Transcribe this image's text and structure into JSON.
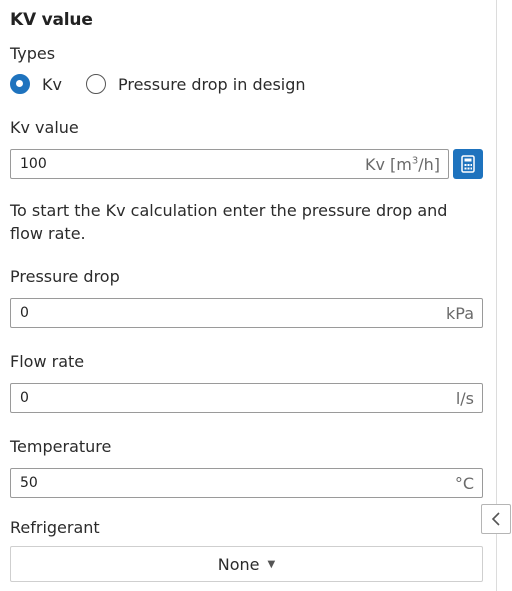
{
  "panel": {
    "title": "KV value",
    "types_label": "Types",
    "types": [
      {
        "label": "Kv",
        "selected": true
      },
      {
        "label": "Pressure drop in design",
        "selected": false
      }
    ],
    "kv_label": "Kv value",
    "kv_value": "100",
    "kv_unit_prefix": "Kv [m",
    "kv_unit_sup": "3",
    "kv_unit_suffix": "/h]",
    "info_text": "To start the Kv calculation enter the pressure drop and flow rate.",
    "pressure_label": "Pressure drop",
    "pressure_value": "0",
    "pressure_unit": "kPa",
    "flow_label": "Flow rate",
    "flow_value": "0",
    "flow_unit": "l/s",
    "temp_label": "Temperature",
    "temp_value": "50",
    "temp_unit": "°C",
    "refrigerant_label": "Refrigerant",
    "refrigerant_selected": "None"
  },
  "icons": {
    "calculator": "calculator-icon",
    "caret": "caret-down-icon",
    "collapse": "chevron-left-icon"
  },
  "colors": {
    "accent": "#1e73be"
  }
}
